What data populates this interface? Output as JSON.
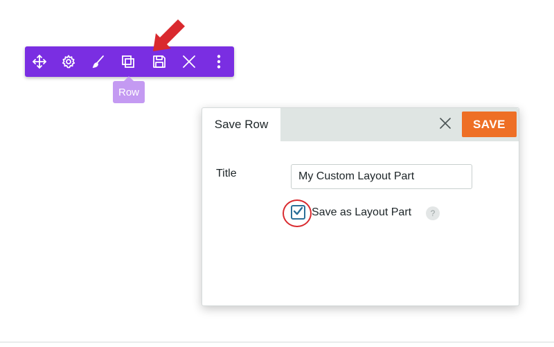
{
  "toolbar": {
    "background": "#7a2ee2",
    "buttons": [
      {
        "icon": "move-icon"
      },
      {
        "icon": "gear-icon"
      },
      {
        "icon": "brush-icon"
      },
      {
        "icon": "duplicate-icon"
      },
      {
        "icon": "save-floppy-icon"
      },
      {
        "icon": "close-icon"
      },
      {
        "icon": "more-vertical-icon"
      }
    ],
    "tooltip": "Row",
    "tooltip_color": "#c49af2"
  },
  "pointer_arrow_color": "#d9292e",
  "dialog": {
    "tab_label": "Save Row",
    "save_label": "SAVE",
    "save_color": "#ee6f25",
    "title_label": "Title",
    "title_value": "My Custom Layout Part",
    "checkbox_label": "Save as Layout Part",
    "checkbox_checked": true,
    "help_icon": "?",
    "highlight_color": "#d9292e"
  }
}
